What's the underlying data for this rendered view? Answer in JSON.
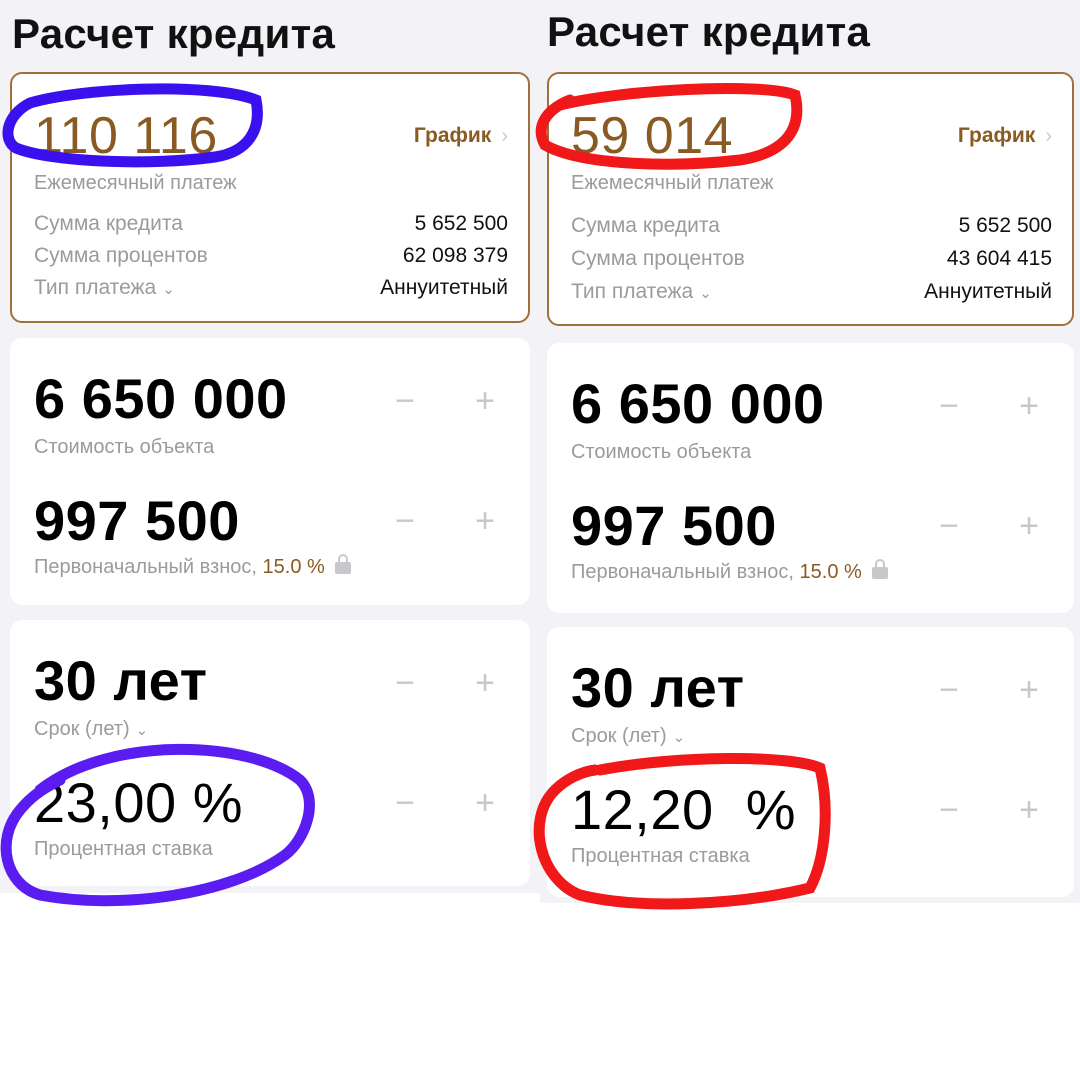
{
  "panels": [
    {
      "title": "Расчет кредита",
      "monthly_payment": "110 116",
      "monthly_payment_label": "Ежемесячный платеж",
      "schedule_label": "График",
      "loan_amount_label": "Сумма кредита",
      "loan_amount": "5 652 500",
      "interest_total_label": "Сумма процентов",
      "interest_total": "62 098 379",
      "payment_type_label": "Тип платежа",
      "payment_type": "Аннуитетный",
      "property_price": "6 650 000",
      "property_price_label": "Стоимость объекта",
      "down_payment": "997 500",
      "down_payment_label": "Первоначальный взнос,",
      "down_payment_percent": "15.0 %",
      "term": "30 лет",
      "term_label": "Срок (лет)",
      "rate": "23,00 %",
      "rate_label": "Процентная ставка",
      "highlight_color": "#3a10ee",
      "rate_highlight_color": "#5a1cf0"
    },
    {
      "title": "Расчет кредита",
      "monthly_payment": "59 014",
      "monthly_payment_label": "Ежемесячный платеж",
      "schedule_label": "График",
      "loan_amount_label": "Сумма кредита",
      "loan_amount": "5 652 500",
      "interest_total_label": "Сумма процентов",
      "interest_total": "43 604 415",
      "payment_type_label": "Тип платежа",
      "payment_type": "Аннуитетный",
      "property_price": "6 650 000",
      "property_price_label": "Стоимость объекта",
      "down_payment": "997 500",
      "down_payment_label": "Первоначальный взнос,",
      "down_payment_percent": "15.0 %",
      "term": "30 лет",
      "term_label": "Срок (лет)",
      "rate": "12,20  %",
      "rate_label": "Процентная ставка",
      "highlight_color": "#f01818",
      "rate_highlight_color": "#f01818"
    }
  ],
  "controls": {
    "minus": "−",
    "plus": "+",
    "chevron_right": "›",
    "chevron_down": "⌄"
  },
  "colors": {
    "accent": "#8a5a23",
    "background": "#f2f2f7",
    "muted_text": "#9a9a9f"
  }
}
